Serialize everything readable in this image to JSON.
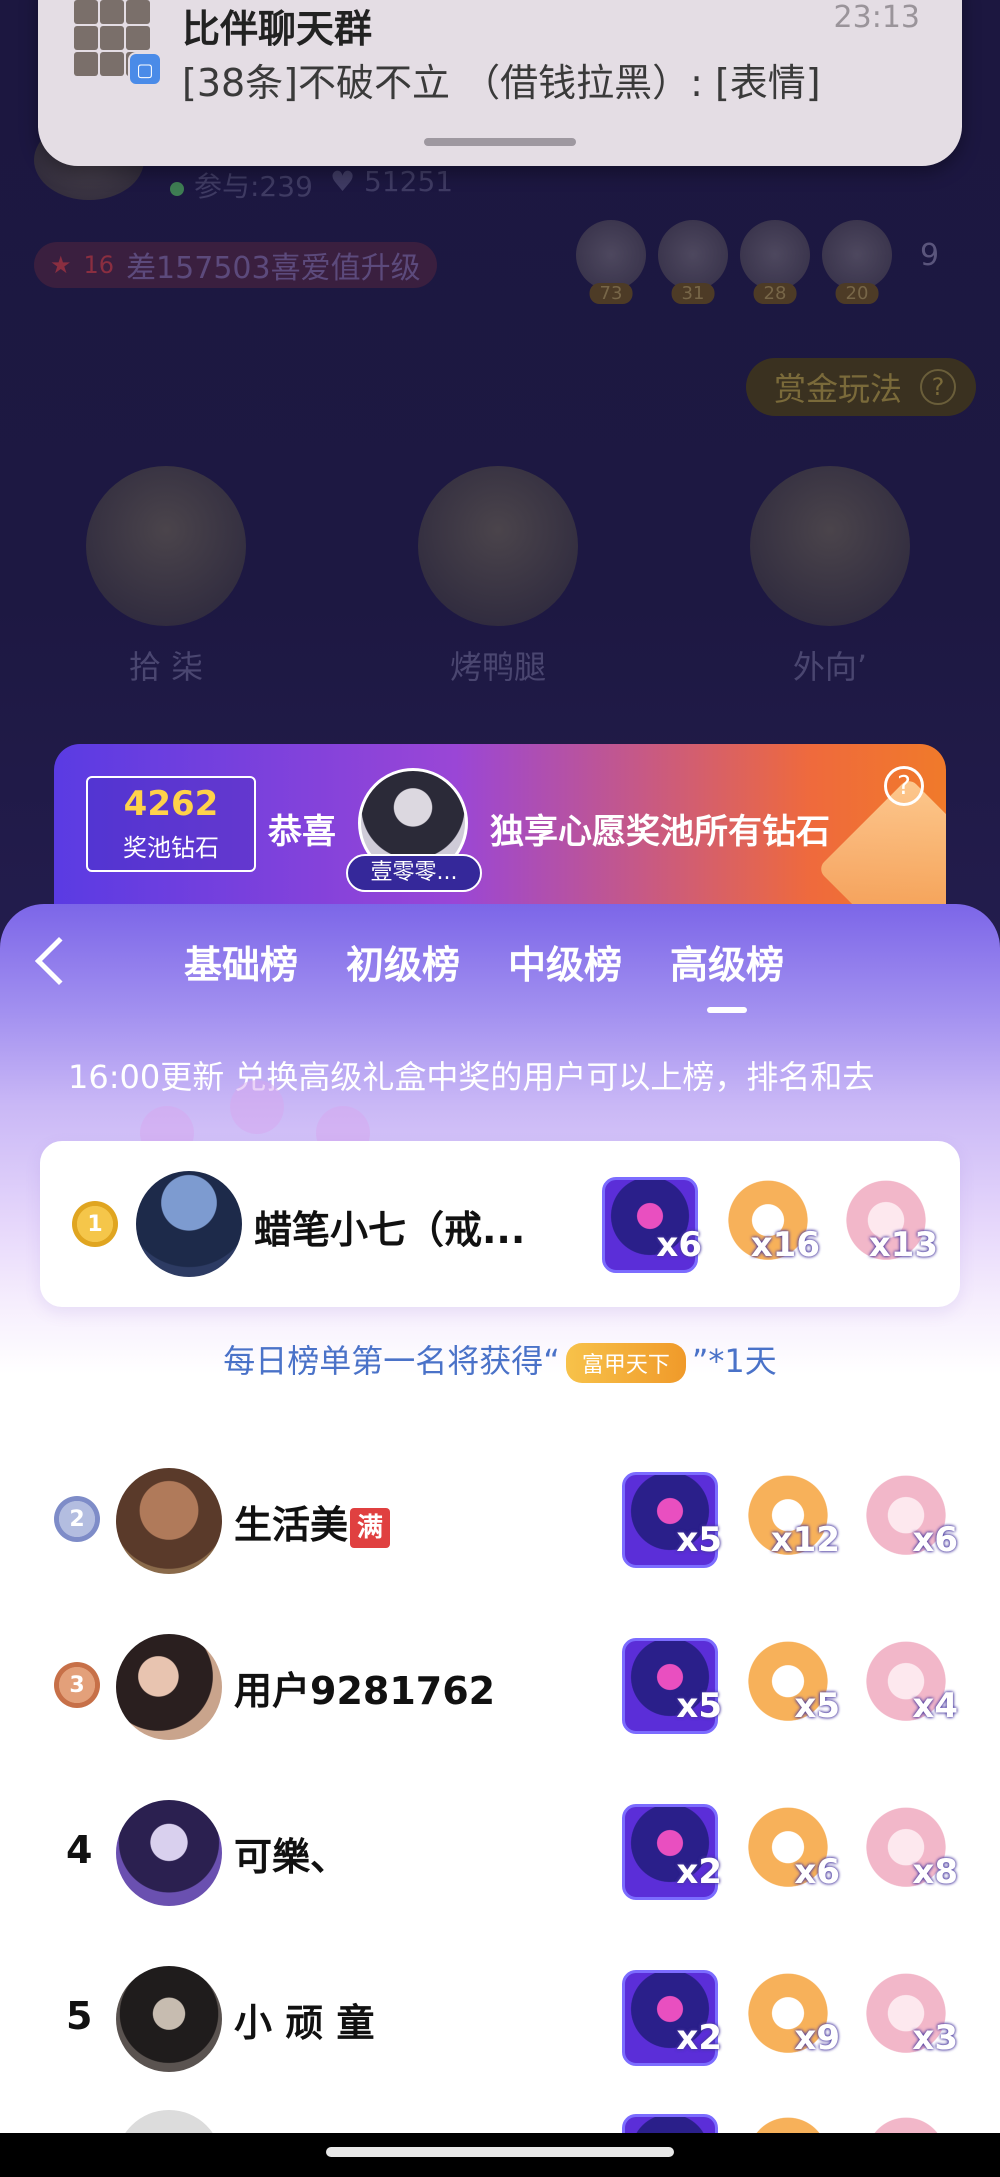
{
  "background": {
    "host_stats": {
      "participants": "参与:239",
      "likes": "51251"
    },
    "level": {
      "badge": "16",
      "text": "差157503喜爱值升级"
    },
    "fans": [
      "73",
      "31",
      "28",
      "20"
    ],
    "more_count": "9",
    "bounty_button": "赏金玩法",
    "seats": [
      "拾 柒",
      "烤鸭腿",
      "外向’"
    ]
  },
  "notification": {
    "title": "比伴聊天群",
    "time": "23:13",
    "body": "[38条]不破不立 （借钱拉黑）: [表情]"
  },
  "banner": {
    "pool_value": "4262",
    "pool_label": "奖池钻石",
    "congrats": "恭喜",
    "winner_name": "壹零零...",
    "exclusive_text": "独享心愿奖池所有钻石"
  },
  "sheet": {
    "tabs": [
      "基础榜",
      "初级榜",
      "中级榜",
      "高级榜"
    ],
    "active_tab": 3,
    "ticker": "16:00更新 兑换高级礼盒中奖的用户可以上榜，排名和去",
    "reward_prefix": "每日榜单第一名将获得“",
    "reward_chip": "富甲天下",
    "reward_suffix": "”*1天"
  },
  "ranking": [
    {
      "rank": "1",
      "name": "蜡笔小七（戒...",
      "gifts": [
        "x6",
        "x16",
        "x13"
      ]
    },
    {
      "rank": "2",
      "name": "生活美",
      "badge": "满",
      "gifts": [
        "x5",
        "x12",
        "x6"
      ]
    },
    {
      "rank": "3",
      "name": "用户9281762",
      "gifts": [
        "x5",
        "x5",
        "x4"
      ]
    },
    {
      "rank": "4",
      "name": "可樂、",
      "gifts": [
        "x2",
        "x6",
        "x8"
      ]
    },
    {
      "rank": "5",
      "name": "小 顽 童",
      "gifts": [
        "x2",
        "x9",
        "x3"
      ]
    }
  ],
  "icons": {
    "back": "chevron-left-icon",
    "help": "question-icon",
    "medals": [
      "gold-medal-icon",
      "silver-medal-icon",
      "bronze-medal-icon"
    ]
  },
  "colors": {
    "sheet_top": "#7c66e8",
    "pool_value": "#ffd24a",
    "reward_text": "#4a72c8"
  }
}
